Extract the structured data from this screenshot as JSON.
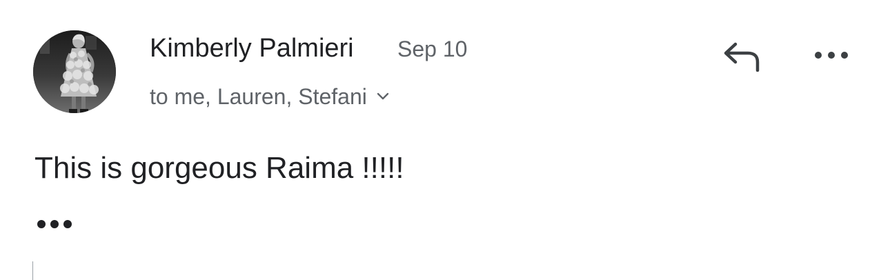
{
  "email": {
    "sender_name": "Kimberly Palmieri",
    "date": "Sep 10",
    "recipients": "to me, Lauren, Stefani",
    "body": "This is gorgeous Raima !!!!!"
  },
  "icons": {
    "avatar": "avatar-photo",
    "recipients_toggle": "chevron-down-icon",
    "reply": "reply-icon",
    "more": "more-horizontal-icon",
    "quoted_toggle": "ellipsis-icon"
  },
  "colors": {
    "primary_text": "#202124",
    "secondary_text": "#5f6368",
    "icon": "#3c4043",
    "background": "#ffffff"
  }
}
